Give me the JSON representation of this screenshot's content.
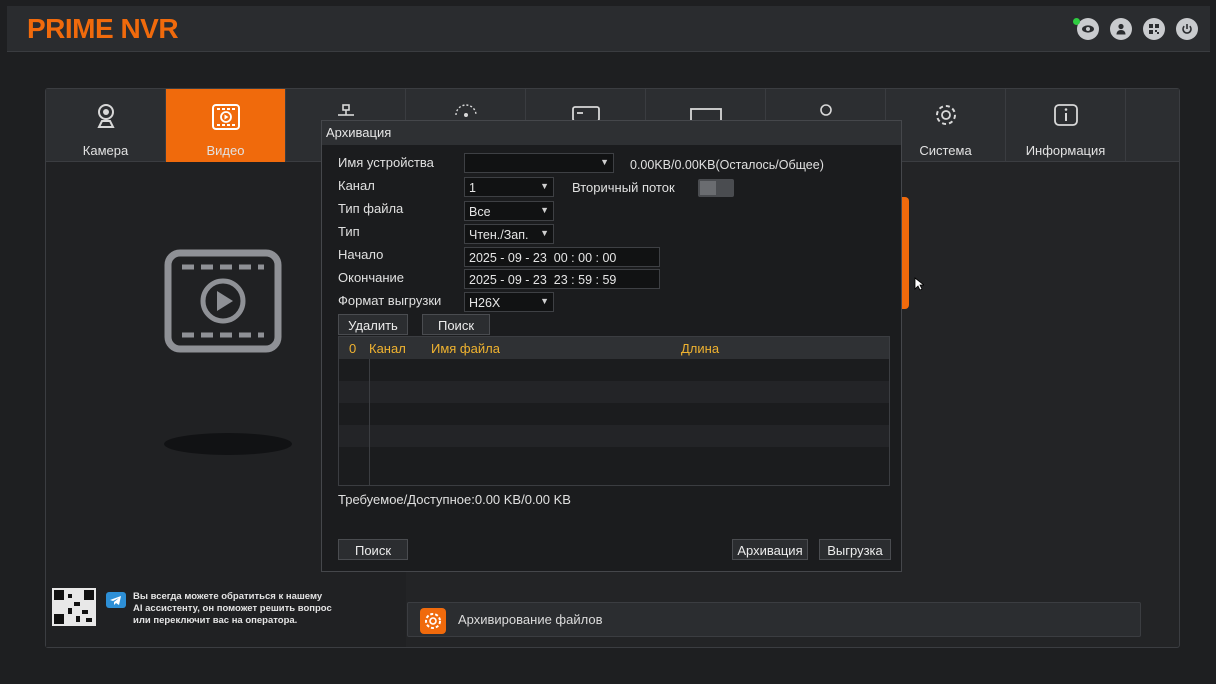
{
  "app": {
    "brand": "PRIME NVR",
    "accent_color": "#f06a0c"
  },
  "topbar_icons": [
    "eye-icon",
    "user-icon",
    "qr-icon",
    "power-icon"
  ],
  "nav": {
    "items": [
      {
        "label": "Камера",
        "icon": "camera-icon"
      },
      {
        "label": "Видео",
        "icon": "video-icon",
        "active": true
      },
      {
        "label": "",
        "icon": "network-icon"
      },
      {
        "label": "",
        "icon": "wireless-icon"
      },
      {
        "label": "",
        "icon": "storage-icon"
      },
      {
        "label": "",
        "icon": "display-icon"
      },
      {
        "label": "",
        "icon": "account-icon"
      },
      {
        "label": "Система",
        "icon": "gear-icon"
      },
      {
        "label": "Информация",
        "icon": "info-icon"
      }
    ]
  },
  "support": {
    "line1": "Вы всегда можете обратиться к нашему",
    "line2": "AI ассистенту, он поможет решить вопрос",
    "line3": "или переключит вас на оператора."
  },
  "statusbar": {
    "text": "Архивирование файлов"
  },
  "dialog": {
    "title": "Архивация",
    "device_label": "Имя устройства",
    "device_value": "",
    "capacity": "0.00KB/0.00KB(Осталось/Общее)",
    "channel_label": "Канал",
    "channel_value": "1",
    "substream_label": "Вторичный поток",
    "filetype_label": "Тип файла",
    "filetype_value": "Все",
    "type_label": "Тип",
    "type_value": "Чтен./Зап.",
    "start_label": "Начало",
    "start_date": "2025 - 09 - 23",
    "start_time": "00 : 00 : 00",
    "end_label": "Окончание",
    "end_date": "2025 - 09 - 23",
    "end_time": "23 : 59 : 59",
    "format_label": "Формат выгрузки",
    "format_value": "H26X",
    "delete_button": "Удалить",
    "search_button_top": "Поиск",
    "table": {
      "col_count": "0",
      "col_channel": "Канал",
      "col_filename": "Имя файла",
      "col_length": "Длина",
      "rows": []
    },
    "required_available": "Требуемое/Доступное:0.00 KB/0.00 KB",
    "search_button_bottom": "Поиск",
    "archive_button": "Архивация",
    "export_button": "Выгрузка"
  }
}
